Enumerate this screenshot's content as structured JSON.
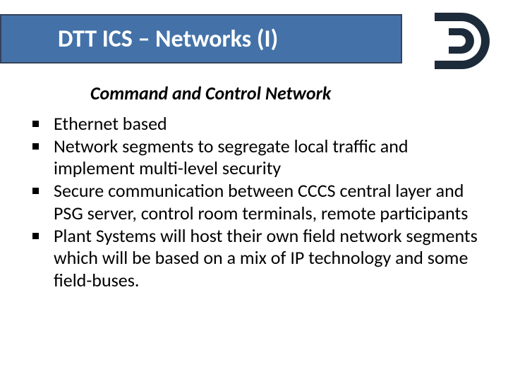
{
  "title": "DTT ICS – Networks (I)",
  "subtitle": "Command and Control Network",
  "bullets": [
    "Ethernet based",
    "Network segments to segregate local traffic and implement multi-level security",
    "Secure communication between CCCS central layer and PSG server, control room terminals, remote participants",
    "Plant Systems will host their own field network segments which will be based on a mix of IP technology and some field-buses."
  ],
  "logo": {
    "name": "dtt-logo"
  }
}
